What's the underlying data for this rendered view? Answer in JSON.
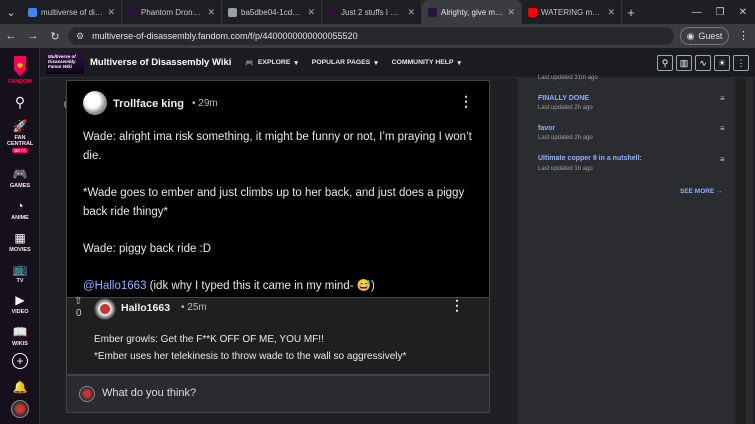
{
  "browser": {
    "tabs": [
      {
        "title": "multiverse of disass",
        "favicon_color": "#4285f4",
        "active": false
      },
      {
        "title": "Phantom Drone | Mu",
        "favicon_color": "#2a1240",
        "active": false
      },
      {
        "title": "ba5dbe04-1cd8-445",
        "favicon_color": "#9aa0a6",
        "active": false
      },
      {
        "title": "Just 2 stuffs I made",
        "favicon_color": "#2a1240",
        "active": false
      },
      {
        "title": "Alrighty, give me a p",
        "favicon_color": "#2a1240",
        "active": true
      },
      {
        "title": "WATERING my TAR",
        "favicon_color": "#ff0000",
        "active": false
      }
    ],
    "url": "multiverse-of-disassembly.fandom.com/f/p/4400000000000055520",
    "profile_label": "Guest"
  },
  "rail": {
    "fandom_label": "FANDOM",
    "fan_central_label": "FAN CENTRAL",
    "beta_label": "BETA",
    "games_label": "GAMES",
    "anime_label": "ANIME",
    "movies_label": "MOVIES",
    "tv_label": "TV",
    "video_label": "VIDEO",
    "wikis_label": "WIKIS"
  },
  "wiki": {
    "logo_text": "Multiverse of Disassembly Fanon Wiki",
    "name": "Multiverse of Disassembly Wiki",
    "nav": [
      "EXPLORE",
      "POPULAR PAGES",
      "COMMUNITY HELP"
    ]
  },
  "post": {
    "author": "Trollface king",
    "time": "29m",
    "vote_count": "0",
    "paragraphs": [
      "Wade: alright ima risk something, it might be funny or not, I’m praying I won’t die.",
      "*Wade goes to ember and just climbs up to her back, and just does a piggy back ride thingy*",
      "Wade: piggy back ride :D"
    ],
    "mention": "@Hallo1663",
    "mention_rest": " (idk why I typed this it came in my mind- 😅)"
  },
  "reply": {
    "author": "Hallo1663",
    "time": "25m",
    "vote_count": "0",
    "lines": [
      "Ember growls: Get the F**K OFF OF ME, YOU MF!!",
      "*Ember uses her telekinesis to throw wade to the wall so aggressively*"
    ]
  },
  "composer": {
    "placeholder": "What do you think?"
  },
  "sidebar": {
    "items": [
      {
        "title": "",
        "sub": "Last updated 31m ago"
      },
      {
        "title": "FINALLY DONE",
        "sub": "Last updated 2h ago"
      },
      {
        "title": "favor",
        "sub": "Last updated 2h ago"
      },
      {
        "title": "Ultimate copper 9 in a nutshell:",
        "sub": "Last updated 1h ago"
      }
    ],
    "see_more": "SEE MORE"
  }
}
